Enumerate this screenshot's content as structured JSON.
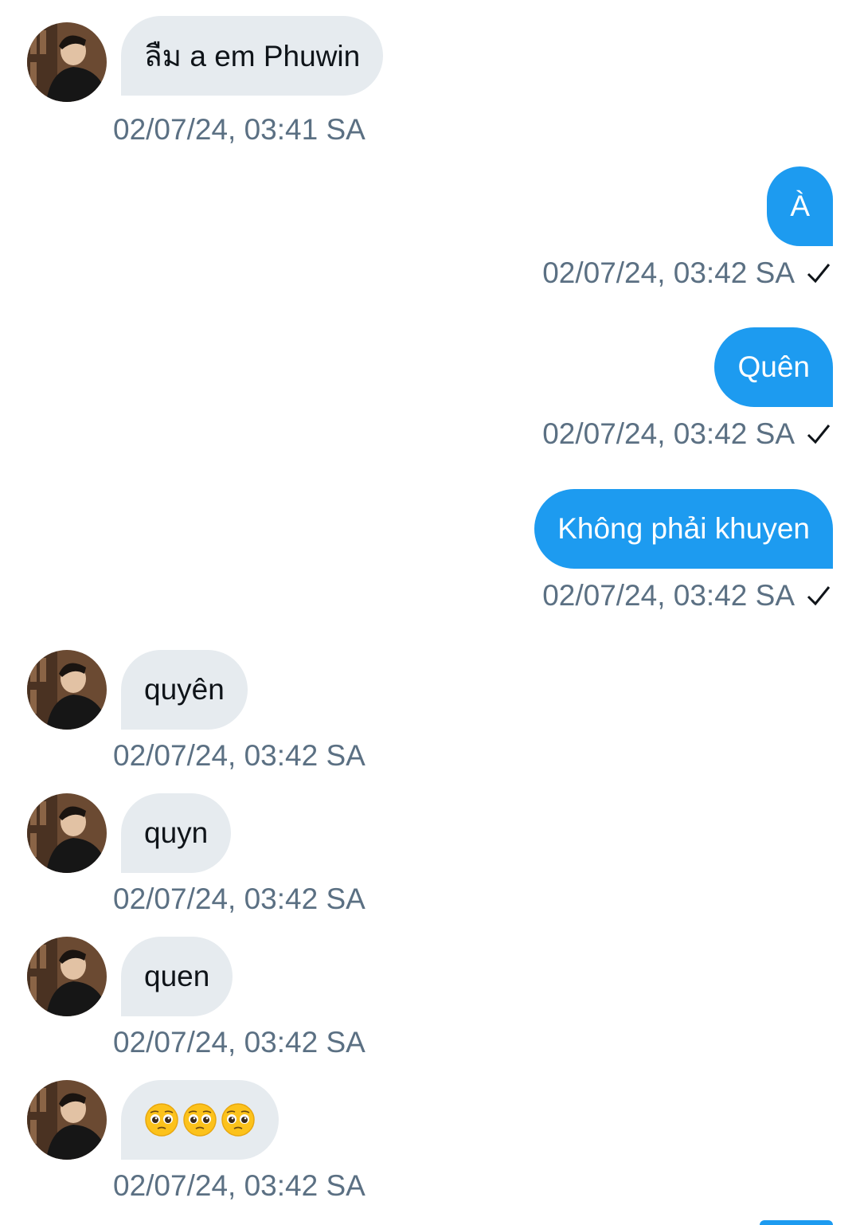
{
  "colors": {
    "incoming_bubble": "#e6ebef",
    "outgoing_bubble": "#1d9bf0",
    "timestamp": "#5b7083"
  },
  "messages": [
    {
      "direction": "in",
      "text": "ลืม a em Phuwin",
      "time": "02/07/24, 03:41 SA"
    },
    {
      "direction": "out",
      "text": "À",
      "time": "02/07/24, 03:42 SA",
      "status_icon": "checkmark-icon"
    },
    {
      "direction": "out",
      "text": "Quên",
      "time": "02/07/24, 03:42 SA",
      "status_icon": "checkmark-icon"
    },
    {
      "direction": "out",
      "text": "Không phải khuyen",
      "time": "02/07/24, 03:42 SA",
      "status_icon": "checkmark-icon"
    },
    {
      "direction": "in",
      "text": "quyên",
      "time": "02/07/24, 03:42 SA"
    },
    {
      "direction": "in",
      "text": "quyn",
      "time": "02/07/24, 03:42 SA"
    },
    {
      "direction": "in",
      "text": "quen",
      "time": "02/07/24, 03:42 SA"
    },
    {
      "direction": "in",
      "emojis": [
        "pleading-face",
        "pleading-face",
        "pleading-face"
      ],
      "time": "02/07/24, 03:42 SA"
    }
  ]
}
